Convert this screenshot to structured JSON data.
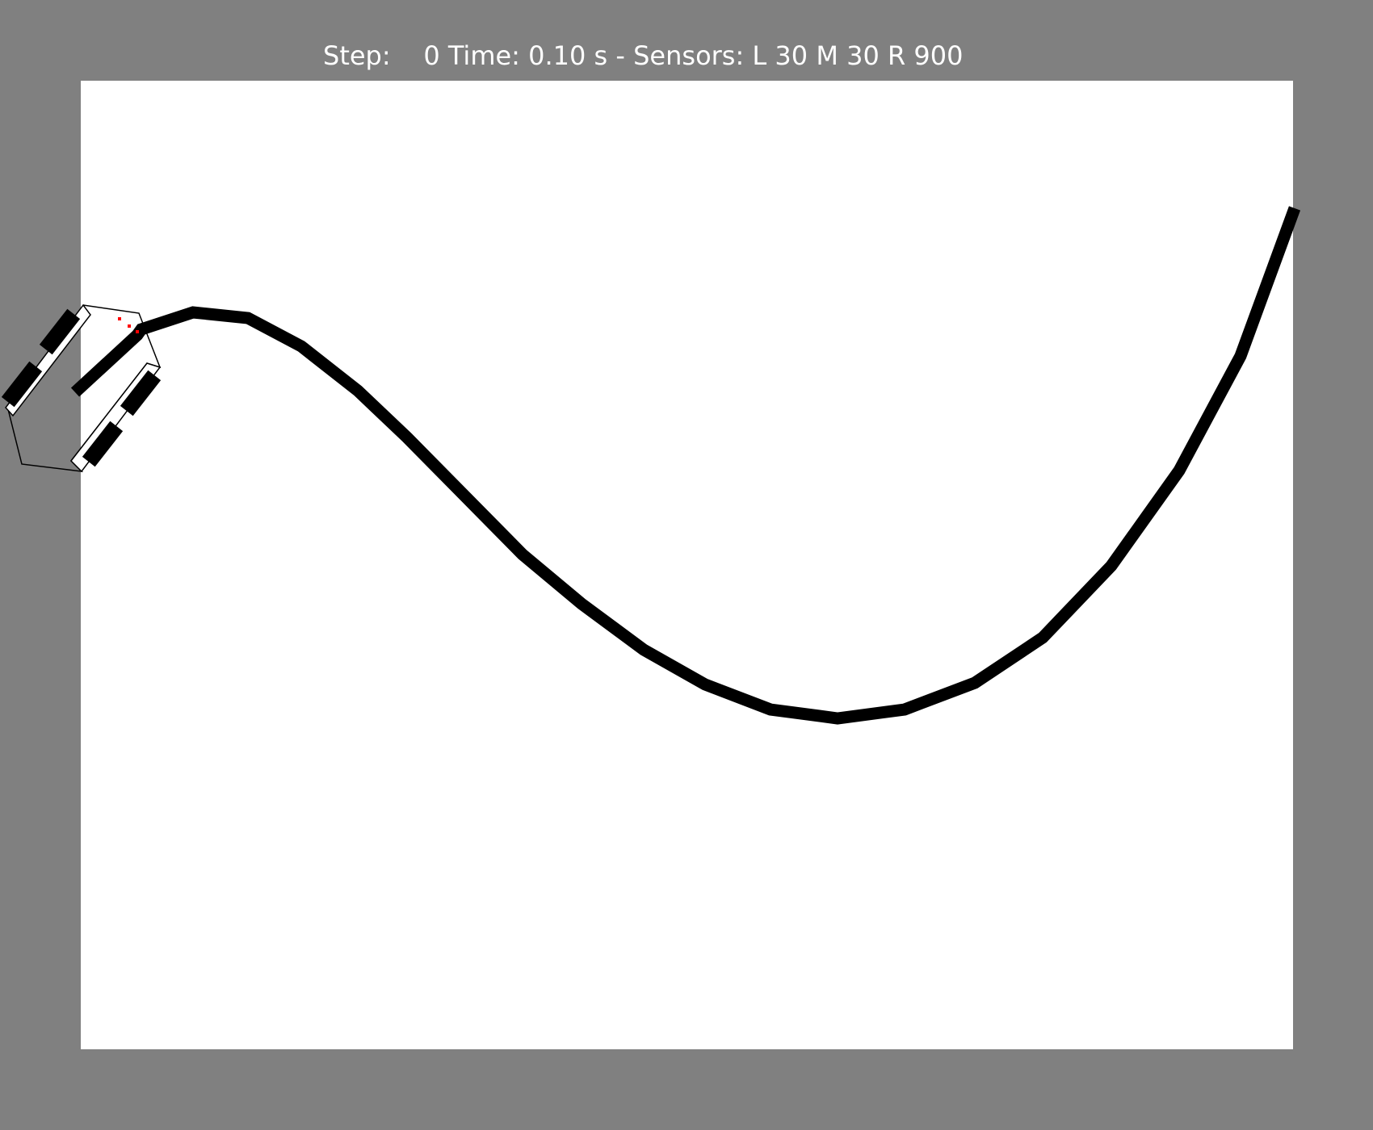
{
  "status": {
    "text": "Step:    0 Time: 0.10 s - Sensors: L 30 M 30 R 900",
    "step": 0,
    "time_s": 0.1,
    "sensors": {
      "L": 30,
      "M": 30,
      "R": 900
    }
  },
  "colors": {
    "background": "#808080",
    "arena": "#ffffff",
    "track": "#000000",
    "robot_outline": "#000000",
    "wheel": "#000000",
    "sensor": "#ff0000",
    "status_text": "#ffffff"
  }
}
